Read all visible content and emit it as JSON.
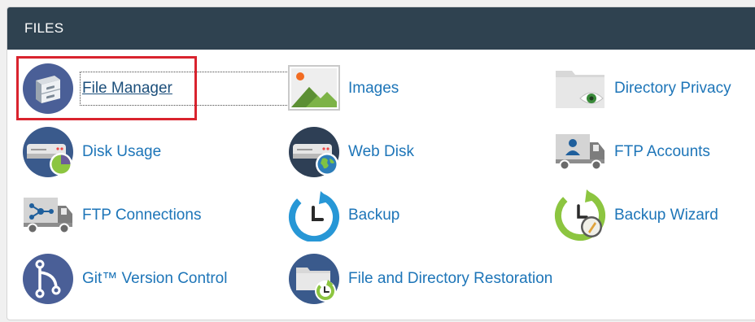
{
  "panel": {
    "title": "FILES"
  },
  "items": [
    {
      "label": "File Manager",
      "icon": "file-cabinet-icon"
    },
    {
      "label": "Images",
      "icon": "image-icon"
    },
    {
      "label": "Directory Privacy",
      "icon": "folder-eye-icon"
    },
    {
      "label": "Disk Usage",
      "icon": "disk-usage-icon"
    },
    {
      "label": "Web Disk",
      "icon": "web-disk-icon"
    },
    {
      "label": "FTP Accounts",
      "icon": "ftp-truck-user-icon"
    },
    {
      "label": "FTP Connections",
      "icon": "ftp-truck-network-icon"
    },
    {
      "label": "Backup",
      "icon": "backup-clock-icon"
    },
    {
      "label": "Backup Wizard",
      "icon": "backup-wizard-icon"
    },
    {
      "label": "Git™ Version Control",
      "icon": "git-branch-icon"
    },
    {
      "label": "File and Directory Restoration",
      "icon": "folder-restore-icon"
    }
  ],
  "selected_item": "File Manager",
  "colors": {
    "header_bg": "#2f4250",
    "link": "#1d75b8",
    "highlight": "#d9232e",
    "icon_blue": "#3a5a8c",
    "icon_green": "#8cc540"
  }
}
